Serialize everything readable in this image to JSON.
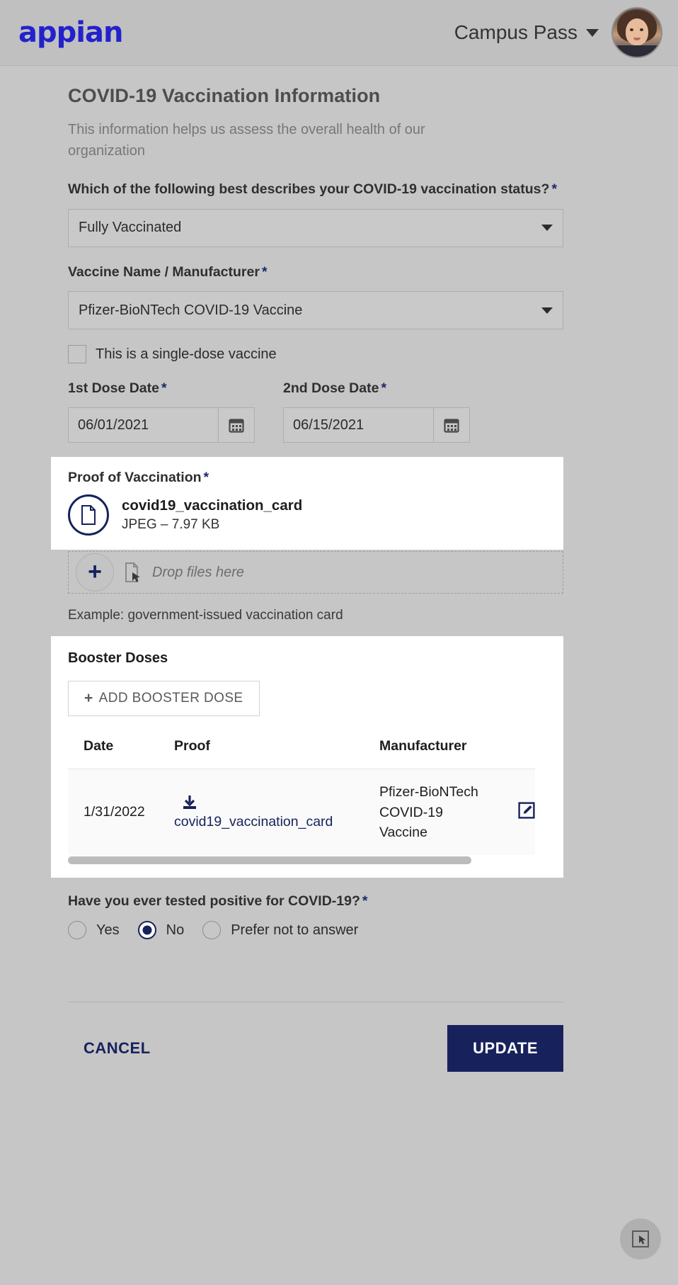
{
  "header": {
    "logo_text": "appian",
    "site_name": "Campus Pass",
    "caret_icon": "chevron-down-icon",
    "avatar_alt": "user-avatar"
  },
  "form": {
    "title": "COVID-19 Vaccination Information",
    "subtitle": "This information helps us assess the overall health of our organization",
    "status_question": "Which of the following best describes your COVID-19 vaccination status?",
    "status_value": "Fully Vaccinated",
    "vaccine_label": "Vaccine Name / Manufacturer",
    "vaccine_value": "Pfizer-BioNTech COVID-19 Vaccine",
    "single_dose_label": "This is a single-dose vaccine",
    "single_dose_checked": false,
    "dose1_label": "1st Dose Date",
    "dose1_value": "06/01/2021",
    "dose2_label": "2nd Dose Date",
    "dose2_value": "06/15/2021",
    "required_marker": "*"
  },
  "proof": {
    "label": "Proof of Vaccination",
    "file_name": "covid19_vaccination_card",
    "file_meta": "JPEG – 7.97 KB",
    "drop_text": "Drop files here",
    "example_text": "Example: government-issued vaccination card"
  },
  "booster": {
    "title": "Booster Doses",
    "add_button": "ADD BOOSTER DOSE",
    "columns": [
      "Date",
      "Proof",
      "Manufacturer"
    ],
    "rows": [
      {
        "date": "1/31/2022",
        "proof": "covid19_vaccination_card",
        "manufacturer": "Pfizer-BioNTech COVID-19 Vaccine",
        "edit_icon": "edit-icon",
        "download_icon": "download-icon"
      }
    ]
  },
  "tested": {
    "question": "Have you ever tested positive for COVID-19?",
    "options": [
      "Yes",
      "No",
      "Prefer not to answer"
    ],
    "selected": "No"
  },
  "footer": {
    "cancel_label": "CANCEL",
    "update_label": "UPDATE"
  },
  "colors": {
    "brand_blue": "#2222cc",
    "accent_navy": "#17225c",
    "page_bg": "#c6c6c6",
    "highlight_bg": "#ffffff"
  }
}
